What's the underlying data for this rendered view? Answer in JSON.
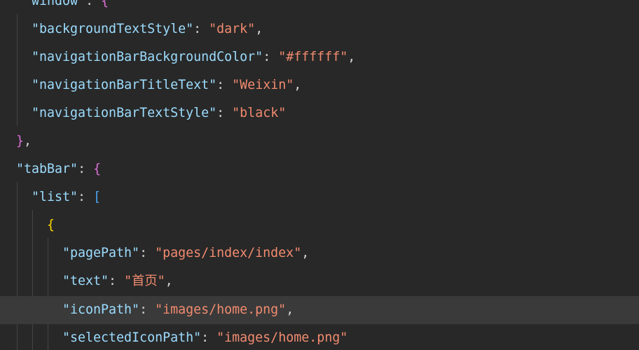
{
  "theme": {
    "background": "#282828",
    "current_line_background": "#3a3a3a",
    "indent_guide": "#444444",
    "token_colors": {
      "key": "#9cdcfe",
      "string": "#f28b6f",
      "punctuation": "#d4d4d4",
      "brace_level1": "#da70d6",
      "bracket_level2": "#4aa5f0",
      "brace_level3": "#ffd700"
    }
  },
  "editor": {
    "current_line": 10,
    "lines": [
      {
        "tokens": [
          {
            "t": "\"window\"",
            "c": "key"
          },
          {
            "t": ": ",
            "c": "punctuation"
          },
          {
            "t": "{",
            "c": "brace_level1"
          }
        ]
      },
      {
        "tokens": [
          {
            "t": "\"backgroundTextStyle\"",
            "c": "key"
          },
          {
            "t": ": ",
            "c": "punctuation"
          },
          {
            "t": "\"dark\"",
            "c": "string"
          },
          {
            "t": ",",
            "c": "punctuation"
          }
        ]
      },
      {
        "tokens": [
          {
            "t": "\"navigationBarBackgroundColor\"",
            "c": "key"
          },
          {
            "t": ": ",
            "c": "punctuation"
          },
          {
            "t": "\"#ffffff\"",
            "c": "string"
          },
          {
            "t": ",",
            "c": "punctuation"
          }
        ]
      },
      {
        "tokens": [
          {
            "t": "\"navigationBarTitleText\"",
            "c": "key"
          },
          {
            "t": ": ",
            "c": "punctuation"
          },
          {
            "t": "\"Weixin\"",
            "c": "string"
          },
          {
            "t": ",",
            "c": "punctuation"
          }
        ]
      },
      {
        "tokens": [
          {
            "t": "\"navigationBarTextStyle\"",
            "c": "key"
          },
          {
            "t": ": ",
            "c": "punctuation"
          },
          {
            "t": "\"black\"",
            "c": "string"
          }
        ]
      },
      {
        "tokens": [
          {
            "t": "}",
            "c": "brace_level1"
          },
          {
            "t": ",",
            "c": "punctuation"
          }
        ]
      },
      {
        "tokens": [
          {
            "t": "\"tabBar\"",
            "c": "key"
          },
          {
            "t": ": ",
            "c": "punctuation"
          },
          {
            "t": "{",
            "c": "brace_level1"
          }
        ]
      },
      {
        "tokens": [
          {
            "t": "\"list\"",
            "c": "key"
          },
          {
            "t": ": ",
            "c": "punctuation"
          },
          {
            "t": "[",
            "c": "bracket_level2"
          }
        ]
      },
      {
        "tokens": [
          {
            "t": "{",
            "c": "brace_level3"
          }
        ]
      },
      {
        "tokens": [
          {
            "t": "\"pagePath\"",
            "c": "key"
          },
          {
            "t": ": ",
            "c": "punctuation"
          },
          {
            "t": "\"pages/index/index\"",
            "c": "string"
          },
          {
            "t": ",",
            "c": "punctuation"
          }
        ]
      },
      {
        "tokens": [
          {
            "t": "\"text\"",
            "c": "key"
          },
          {
            "t": ": ",
            "c": "punctuation"
          },
          {
            "t": "\"首页\"",
            "c": "string"
          },
          {
            "t": ",",
            "c": "punctuation"
          }
        ]
      },
      {
        "tokens": [
          {
            "t": "\"iconPath\"",
            "c": "key"
          },
          {
            "t": ": ",
            "c": "punctuation"
          },
          {
            "t": "\"images/home.png\"",
            "c": "string"
          },
          {
            "t": ",",
            "c": "punctuation"
          }
        ]
      },
      {
        "tokens": [
          {
            "t": "\"selectedIconPath\"",
            "c": "key"
          },
          {
            "t": ": ",
            "c": "punctuation"
          },
          {
            "t": "\"images/home.png\"",
            "c": "string"
          }
        ]
      }
    ]
  }
}
